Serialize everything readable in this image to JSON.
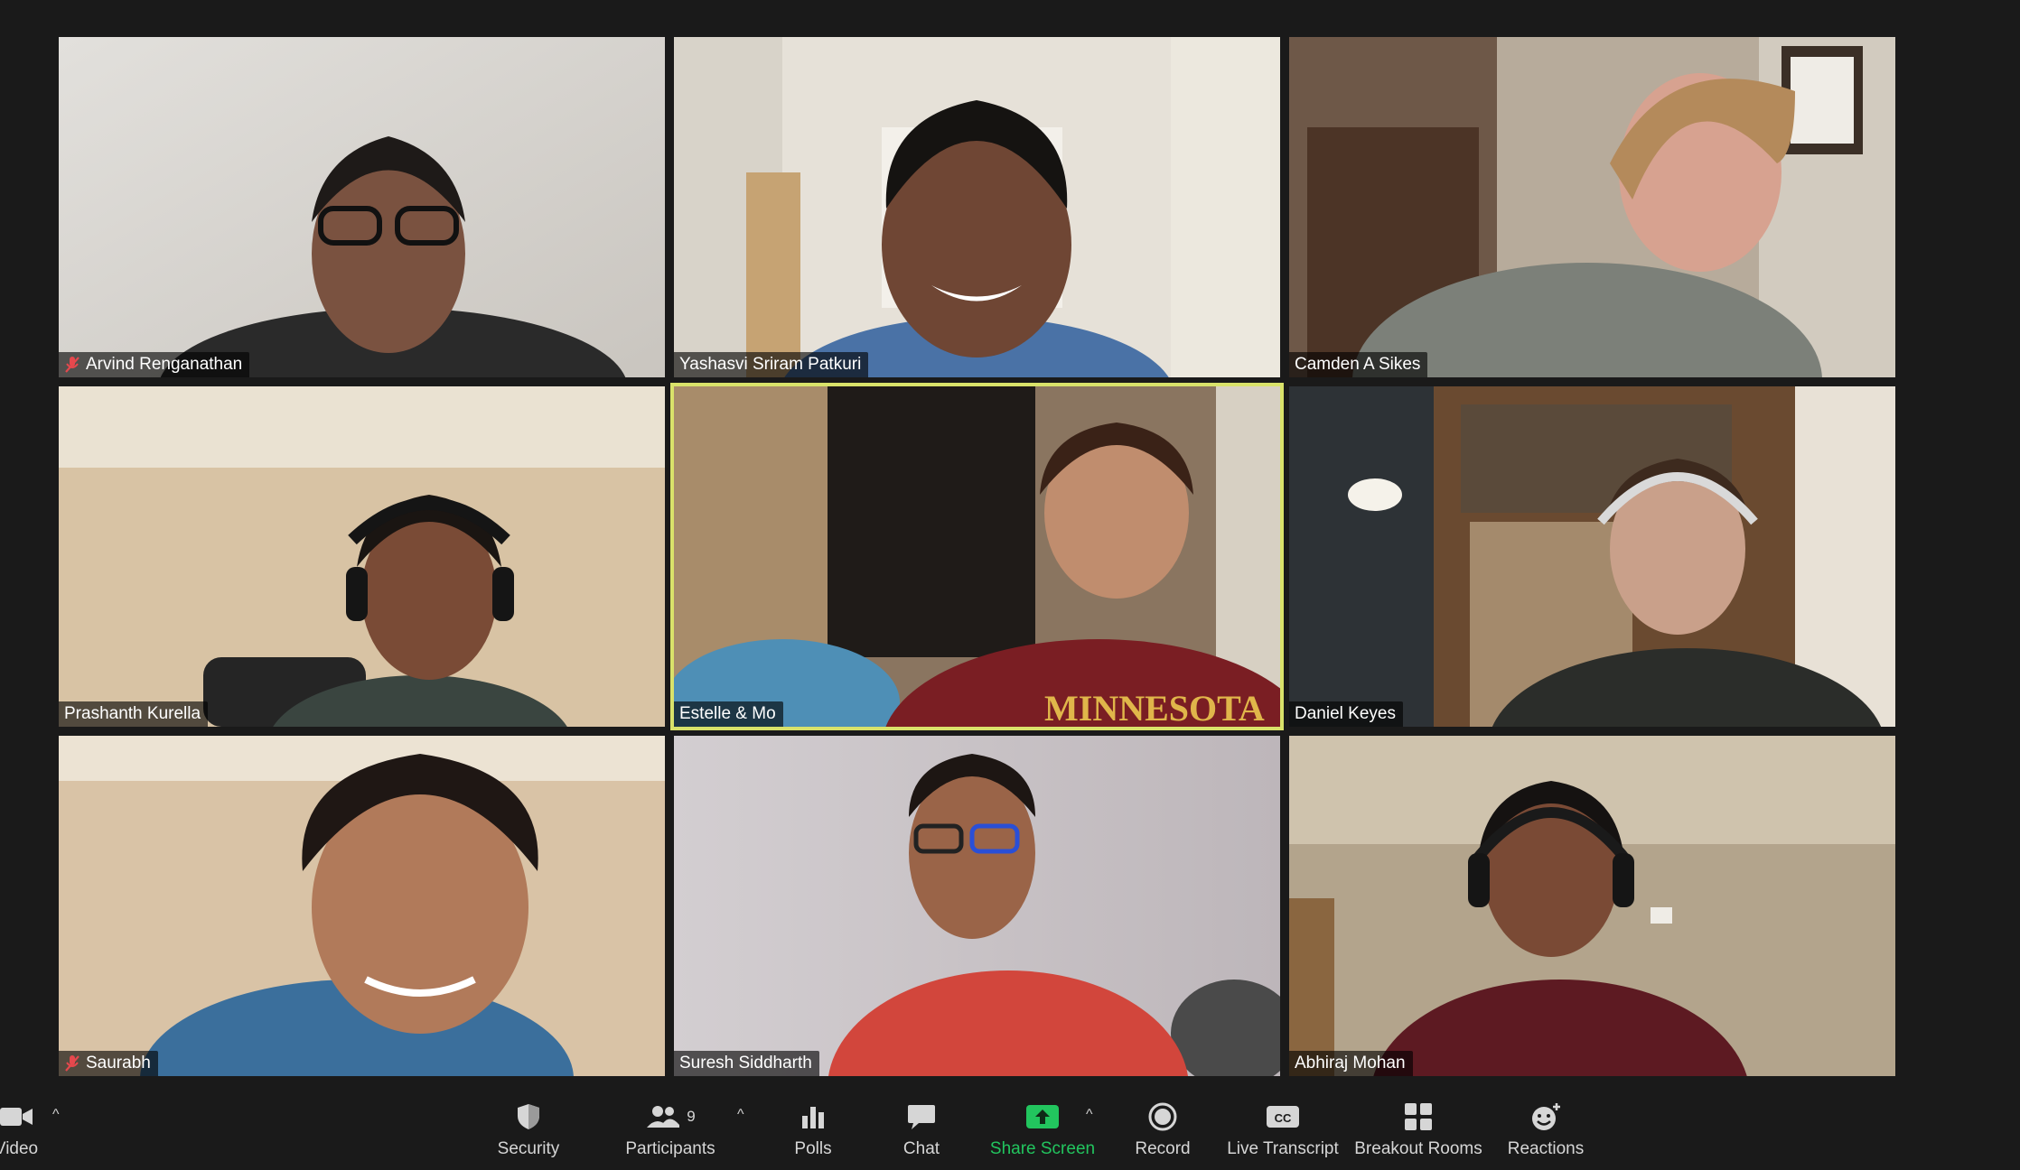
{
  "participants": [
    {
      "name": "Arvind Renganathan",
      "muted": true
    },
    {
      "name": "Yashasvi Sriram Patkuri",
      "muted": false
    },
    {
      "name": "Camden A Sikes",
      "muted": false
    },
    {
      "name": "Prashanth Kurella",
      "muted": false
    },
    {
      "name": "Estelle & Mo",
      "muted": false,
      "active_speaker": true
    },
    {
      "name": "Daniel Keyes",
      "muted": false
    },
    {
      "name": "Saurabh",
      "muted": true
    },
    {
      "name": "Suresh Siddharth",
      "muted": false
    },
    {
      "name": "Abhiraj Mohan",
      "muted": false
    }
  ],
  "toolbar": {
    "video_label": "Video",
    "security_label": "Security",
    "participants_label": "Participants",
    "participants_count": "9",
    "polls_label": "Polls",
    "chat_label": "Chat",
    "share_label": "Share Screen",
    "record_label": "Record",
    "transcript_label": "Live Transcript",
    "breakout_label": "Breakout Rooms",
    "reactions_label": "Reactions",
    "caret": "^"
  },
  "colors": {
    "active_speaker_border": "#d9e26a",
    "share_green": "#22c55e",
    "mute_red": "#e5484d"
  }
}
